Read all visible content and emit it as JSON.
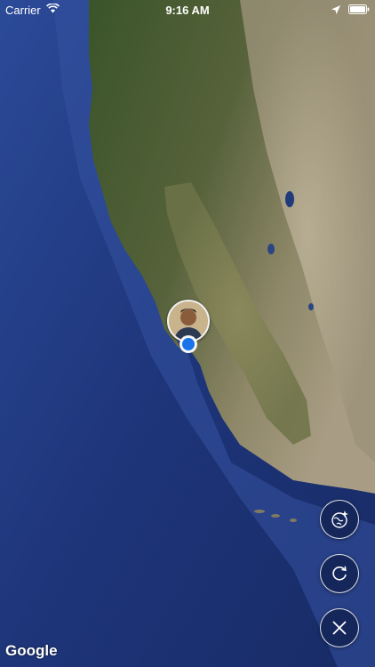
{
  "status_bar": {
    "carrier": "Carrier",
    "time": "9:16 AM",
    "wifi_icon": "wifi-icon",
    "location_icon": "location-arrow-icon",
    "battery_icon": "battery-icon"
  },
  "map": {
    "type": "satellite",
    "attribution": "Google",
    "colors": {
      "ocean_deep": "#1b2f6e",
      "ocean_shelf": "#3d5aa8",
      "land_forest": "#3f5a2c",
      "land_valley": "#7b7f52",
      "land_desert": "#a49a80"
    }
  },
  "controls": {
    "explore_icon": "globe-sparkle-icon",
    "refresh_icon": "refresh-icon",
    "close_icon": "close-icon",
    "button_bg": "#15275a"
  },
  "marker": {
    "avatar": "user-avatar",
    "location_dot_color": "#1a73e8"
  }
}
